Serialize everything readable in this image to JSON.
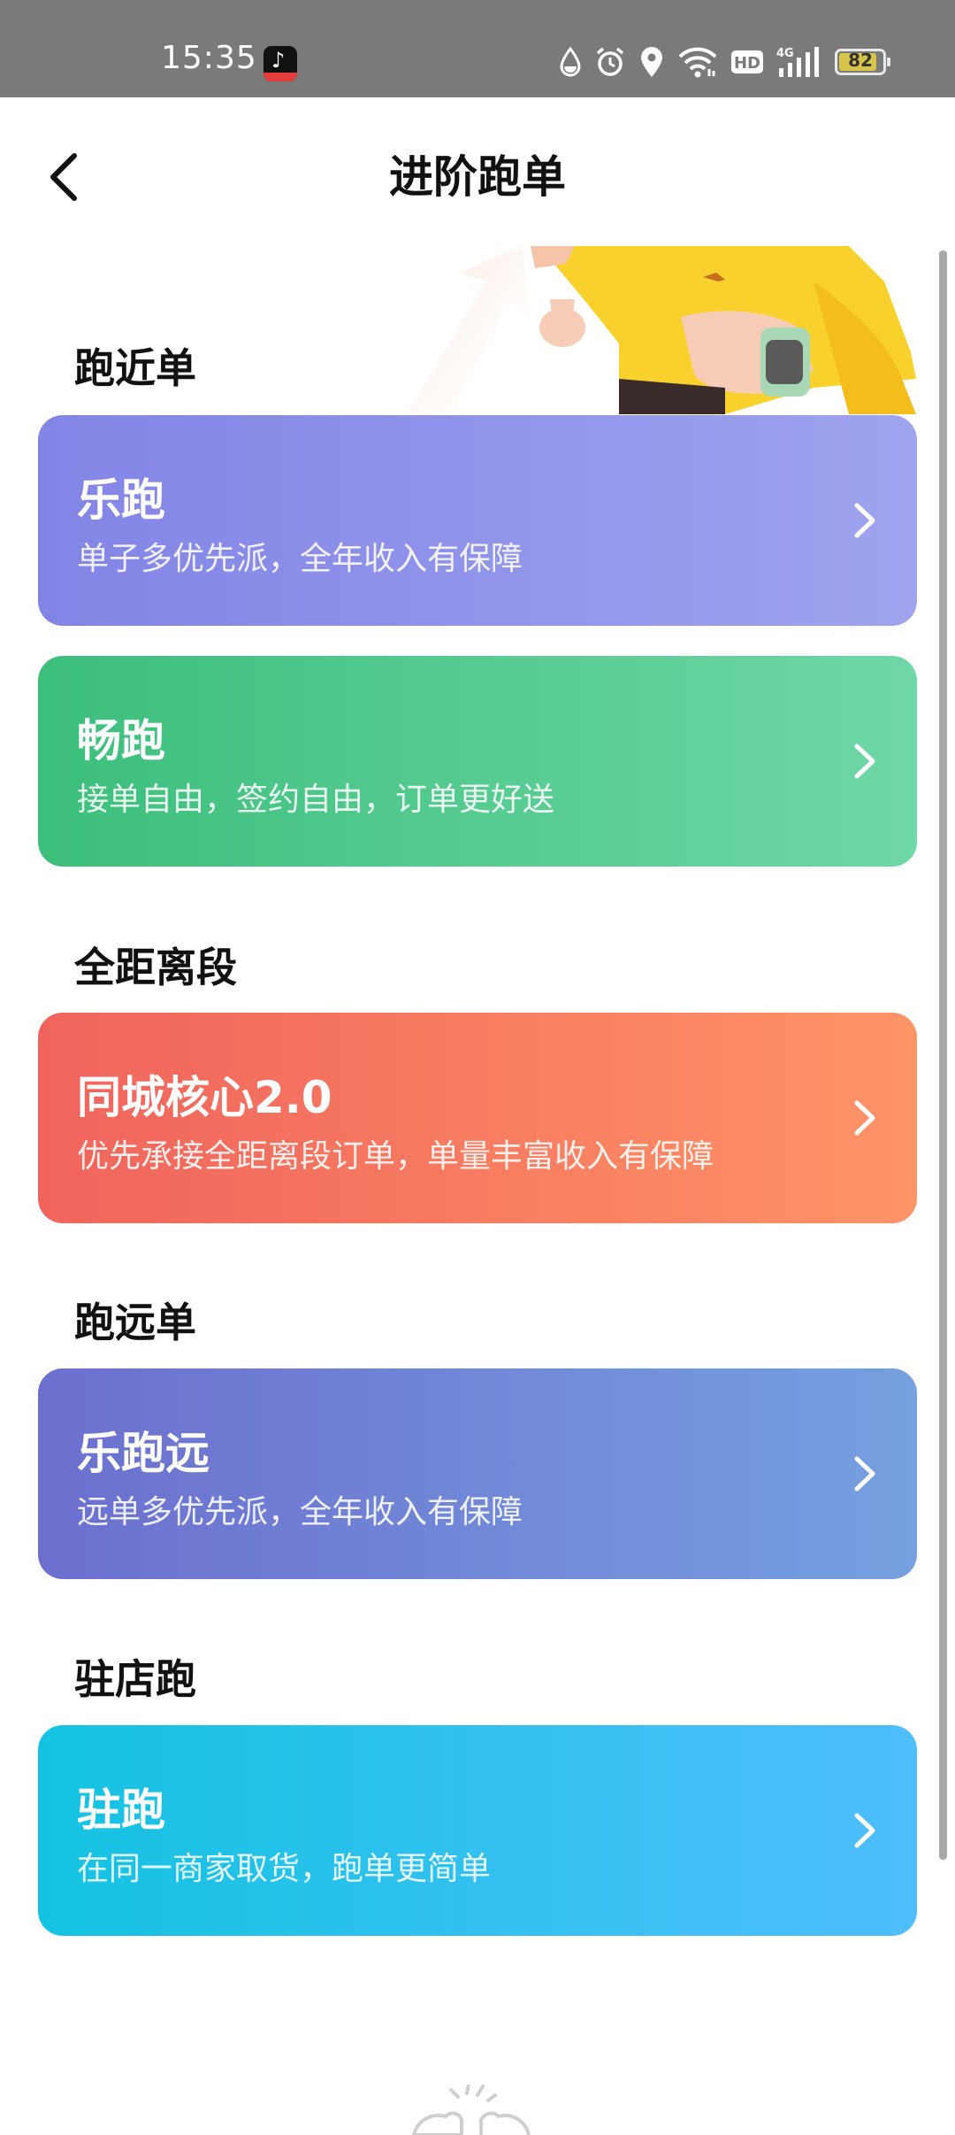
{
  "status_bar": {
    "time": "15:35",
    "battery": "82",
    "network": "4G",
    "hd": "HD",
    "icons": [
      "app-badge-icon",
      "drop-icon",
      "alarm-icon",
      "location-icon",
      "wifi-icon",
      "hd-icon",
      "signal-icon",
      "battery-icon"
    ]
  },
  "header": {
    "title": "进阶跑单",
    "back_icon": "back-arrow-icon"
  },
  "sections": [
    {
      "title": "跑近单",
      "cards": [
        {
          "title": "乐跑",
          "subtitle": "单子多优先派，全年收入有保障",
          "gradient": [
            "#8384e6",
            "#a0a3ee"
          ]
        }
      ]
    },
    {
      "title": "",
      "cards": [
        {
          "title": "畅跑",
          "subtitle": "接单自由，签约自由，订单更好送",
          "gradient": [
            "#3cbf7b",
            "#6fd7a8"
          ]
        }
      ]
    },
    {
      "title": "全距离段",
      "cards": [
        {
          "title": "同城核心2.0",
          "subtitle": "优先承接全距离段订单，单量丰富收入有保障",
          "gradient": [
            "#f0645c",
            "#ff9466"
          ]
        }
      ]
    },
    {
      "title": "跑远单",
      "cards": [
        {
          "title": "乐跑远",
          "subtitle": "远单多优先派，全年收入有保障",
          "gradient": [
            "#6c6fce",
            "#76a0e0"
          ]
        }
      ]
    },
    {
      "title": "驻店跑",
      "cards": [
        {
          "title": "驻跑",
          "subtitle": "在同一商家取货，跑单更简单",
          "gradient": [
            "#14c3e2",
            "#4fbefd"
          ]
        }
      ]
    }
  ],
  "colors": {
    "status_bar_bg": "#7a7a7a",
    "page_bg": "#ffffff",
    "text_primary": "#111111",
    "scrollbar": "#a9a9a9"
  }
}
